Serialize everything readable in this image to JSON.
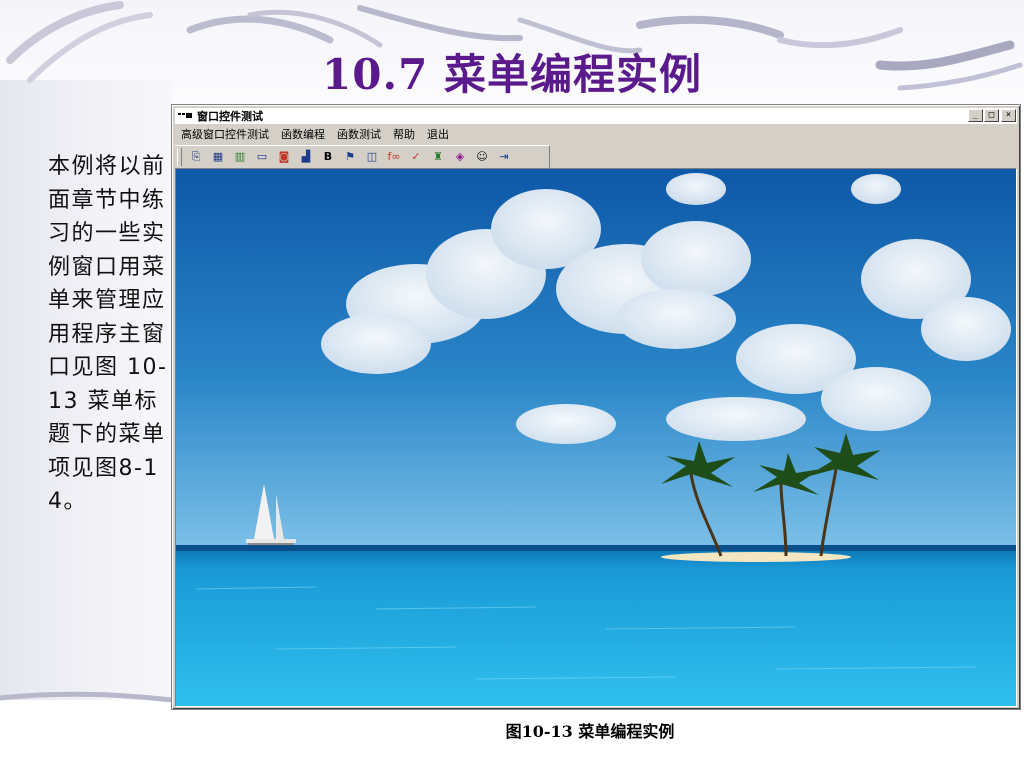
{
  "slide": {
    "title": "10.7 菜单编程实例",
    "body": "本例将以前面章节中练习的一些实例窗口用菜单来管理应用程序主窗口见图 10-13 菜单标题下的菜单项见图8-14。",
    "caption": "图10-13 菜单编程实例"
  },
  "window": {
    "title": "窗口控件测试",
    "controls": {
      "minimize": "_",
      "maximize": "□",
      "close": "×"
    },
    "menu": [
      "高级窗口控件测试",
      "函数编程",
      "函数测试",
      "帮助",
      "退出"
    ],
    "toolbar_icons": [
      "copy-icon",
      "calendar-icon",
      "bar-chart-icon",
      "progress-bar-icon",
      "ocx-icon",
      "chart-icon",
      "bold-icon",
      "flag-icon",
      "book-icon",
      "function-icon",
      "check-icon",
      "growth-icon",
      "disk-icon",
      "smiley-icon",
      "exit-icon"
    ],
    "toolbar_glyphs": [
      "⎘",
      "▦",
      "▥",
      "▭",
      "◙",
      "▟",
      "B",
      "⚑",
      "◫",
      "f∞",
      "✓",
      "♜",
      "◈",
      "☺",
      "⇥"
    ],
    "toolbar_colors": [
      "#1b3a8a",
      "#1b3a8a",
      "#2d7d2d",
      "#1b3a8a",
      "#c0392b",
      "#1b3a8a",
      "#000000",
      "#1b3a8a",
      "#1b3a8a",
      "#c0392b",
      "#c0392b",
      "#2d7d2d",
      "#8e1b8e",
      "#1a1a1a",
      "#1b3a8a"
    ]
  },
  "colors": {
    "title": "#5a1a8c",
    "sky": "#1a6fb8",
    "sea": "#1fa6e0"
  }
}
